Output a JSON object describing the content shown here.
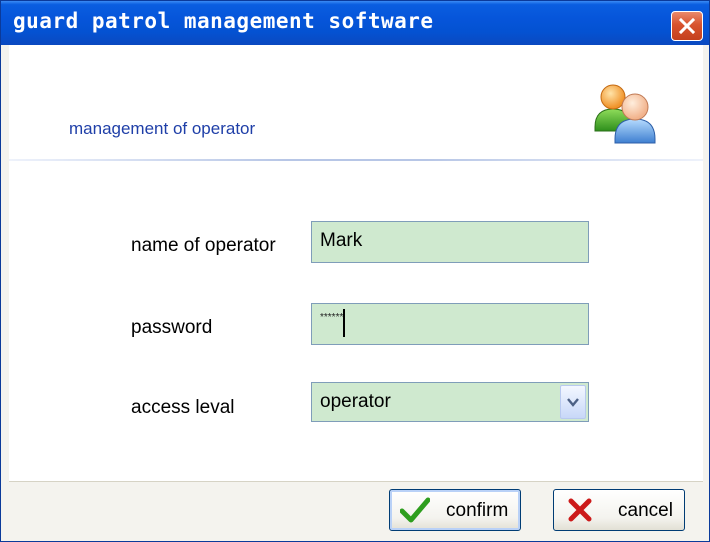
{
  "window": {
    "title": "guard patrol management software"
  },
  "header": {
    "title": "management of operator",
    "icon": "users-icon"
  },
  "form": {
    "name_label": "name of operator",
    "name_value": "Mark",
    "password_label": "password",
    "password_value": "******",
    "access_label": "access leval",
    "access_value": "operator"
  },
  "buttons": {
    "confirm_label": "confirm",
    "cancel_label": "cancel"
  },
  "colors": {
    "titlebar": "#0655da",
    "field_bg": "#cfe9cf",
    "header_text": "#1f3fa8",
    "confirm_icon": "#2e9e1e",
    "cancel_icon": "#cc1a1a"
  }
}
